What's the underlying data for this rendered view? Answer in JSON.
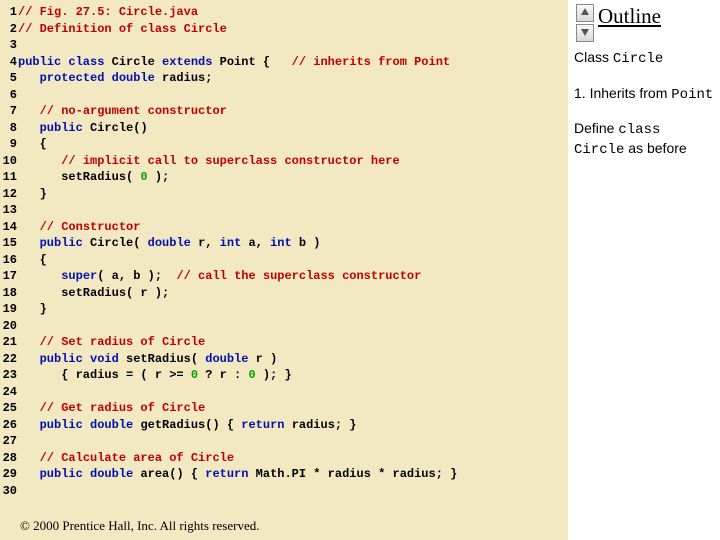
{
  "code": {
    "lines": [
      {
        "n": "1",
        "tokens": [
          {
            "c": "cm",
            "t": "// Fig. 27.5: Circle.java"
          }
        ]
      },
      {
        "n": "2",
        "tokens": [
          {
            "c": "cm",
            "t": "// Definition of class Circle"
          }
        ]
      },
      {
        "n": "3",
        "tokens": []
      },
      {
        "n": "4",
        "tokens": [
          {
            "c": "kw",
            "t": "public class "
          },
          {
            "c": "pl",
            "t": "Circle "
          },
          {
            "c": "kw",
            "t": "extends "
          },
          {
            "c": "pl",
            "t": "Point {   "
          },
          {
            "c": "cm",
            "t": "// inherits from Point"
          }
        ]
      },
      {
        "n": "5",
        "tokens": [
          {
            "c": "pl",
            "t": "   "
          },
          {
            "c": "kw",
            "t": "protected double "
          },
          {
            "c": "pl",
            "t": "radius;"
          }
        ]
      },
      {
        "n": "6",
        "tokens": []
      },
      {
        "n": "7",
        "tokens": [
          {
            "c": "pl",
            "t": "   "
          },
          {
            "c": "cm",
            "t": "// no-argument constructor"
          }
        ]
      },
      {
        "n": "8",
        "tokens": [
          {
            "c": "pl",
            "t": "   "
          },
          {
            "c": "kw",
            "t": "public "
          },
          {
            "c": "pl",
            "t": "Circle()"
          }
        ]
      },
      {
        "n": "9",
        "tokens": [
          {
            "c": "pl",
            "t": "   {"
          }
        ]
      },
      {
        "n": "10",
        "tokens": [
          {
            "c": "pl",
            "t": "      "
          },
          {
            "c": "cm",
            "t": "// implicit call to superclass constructor here"
          }
        ]
      },
      {
        "n": "11",
        "tokens": [
          {
            "c": "pl",
            "t": "      setRadius( "
          },
          {
            "c": "st",
            "t": "0"
          },
          {
            "c": "pl",
            "t": " ); "
          }
        ]
      },
      {
        "n": "12",
        "tokens": [
          {
            "c": "pl",
            "t": "   }"
          }
        ]
      },
      {
        "n": "13",
        "tokens": []
      },
      {
        "n": "14",
        "tokens": [
          {
            "c": "pl",
            "t": "   "
          },
          {
            "c": "cm",
            "t": "// Constructor"
          }
        ]
      },
      {
        "n": "15",
        "tokens": [
          {
            "c": "pl",
            "t": "   "
          },
          {
            "c": "kw",
            "t": "public "
          },
          {
            "c": "pl",
            "t": "Circle( "
          },
          {
            "c": "kw",
            "t": "double "
          },
          {
            "c": "pl",
            "t": "r, "
          },
          {
            "c": "kw",
            "t": "int "
          },
          {
            "c": "pl",
            "t": "a, "
          },
          {
            "c": "kw",
            "t": "int "
          },
          {
            "c": "pl",
            "t": "b )"
          }
        ]
      },
      {
        "n": "16",
        "tokens": [
          {
            "c": "pl",
            "t": "   {"
          }
        ]
      },
      {
        "n": "17",
        "tokens": [
          {
            "c": "pl",
            "t": "      "
          },
          {
            "c": "kw",
            "t": "super"
          },
          {
            "c": "pl",
            "t": "( a, b );  "
          },
          {
            "c": "cm",
            "t": "// call the superclass constructor"
          }
        ]
      },
      {
        "n": "18",
        "tokens": [
          {
            "c": "pl",
            "t": "      setRadius( r );"
          }
        ]
      },
      {
        "n": "19",
        "tokens": [
          {
            "c": "pl",
            "t": "   }"
          }
        ]
      },
      {
        "n": "20",
        "tokens": []
      },
      {
        "n": "21",
        "tokens": [
          {
            "c": "pl",
            "t": "   "
          },
          {
            "c": "cm",
            "t": "// Set radius of Circle"
          }
        ]
      },
      {
        "n": "22",
        "tokens": [
          {
            "c": "pl",
            "t": "   "
          },
          {
            "c": "kw",
            "t": "public void "
          },
          {
            "c": "pl",
            "t": "setRadius( "
          },
          {
            "c": "kw",
            "t": "double "
          },
          {
            "c": "pl",
            "t": "r )"
          }
        ]
      },
      {
        "n": "23",
        "tokens": [
          {
            "c": "pl",
            "t": "      { radius = ( r >= "
          },
          {
            "c": "st",
            "t": "0"
          },
          {
            "c": "pl",
            "t": " ? r : "
          },
          {
            "c": "st",
            "t": "0"
          },
          {
            "c": "pl",
            "t": " ); }"
          }
        ]
      },
      {
        "n": "24",
        "tokens": []
      },
      {
        "n": "25",
        "tokens": [
          {
            "c": "pl",
            "t": "   "
          },
          {
            "c": "cm",
            "t": "// Get radius of Circle"
          }
        ]
      },
      {
        "n": "26",
        "tokens": [
          {
            "c": "pl",
            "t": "   "
          },
          {
            "c": "kw",
            "t": "public double "
          },
          {
            "c": "pl",
            "t": "getRadius() { "
          },
          {
            "c": "kw",
            "t": "return "
          },
          {
            "c": "pl",
            "t": "radius; }"
          }
        ]
      },
      {
        "n": "27",
        "tokens": []
      },
      {
        "n": "28",
        "tokens": [
          {
            "c": "pl",
            "t": "   "
          },
          {
            "c": "cm",
            "t": "// Calculate area of Circle"
          }
        ]
      },
      {
        "n": "29",
        "tokens": [
          {
            "c": "pl",
            "t": "   "
          },
          {
            "c": "kw",
            "t": "public double "
          },
          {
            "c": "pl",
            "t": "area() { "
          },
          {
            "c": "kw",
            "t": "return "
          },
          {
            "c": "pl",
            "t": "Math.PI * radius * radius; }"
          }
        ]
      },
      {
        "n": "30",
        "tokens": []
      }
    ]
  },
  "footer": "© 2000 Prentice Hall, Inc. All rights reserved.",
  "sidebar": {
    "outline_label": "Outline",
    "notes": [
      [
        {
          "c": "",
          "t": "Class "
        },
        {
          "c": "mono",
          "t": "Circle"
        }
      ],
      [
        {
          "c": "",
          "t": "1. Inherits from "
        },
        {
          "c": "mono",
          "t": "Point"
        }
      ],
      [
        {
          "c": "",
          "t": "Define "
        },
        {
          "c": "mono",
          "t": "class Circle"
        },
        {
          "c": "",
          "t": " as before"
        }
      ]
    ]
  }
}
